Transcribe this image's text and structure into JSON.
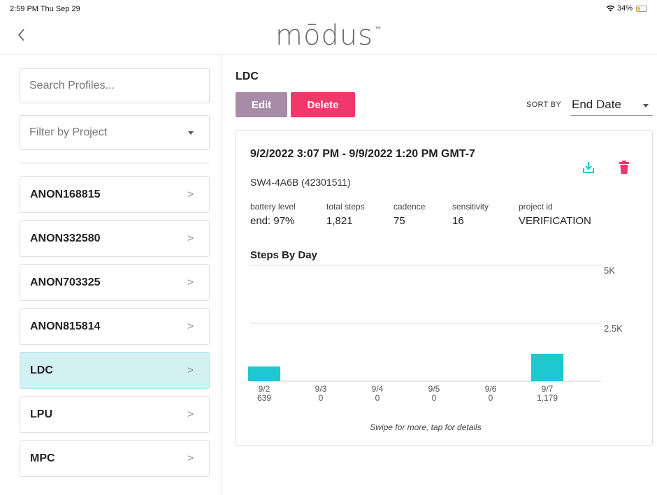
{
  "status_bar": {
    "time": "2:59 PM  Thu Sep 29",
    "battery": "34%",
    "battery_level": 0.34
  },
  "nav": {
    "logo": "mōdus",
    "logo_tm": "™"
  },
  "sidebar": {
    "search_placeholder": "Search Profiles...",
    "filter_label": "Filter by Project",
    "profiles": [
      {
        "name": "ANON168815"
      },
      {
        "name": "ANON332580"
      },
      {
        "name": "ANON703325"
      },
      {
        "name": "ANON815814"
      },
      {
        "name": "LDC"
      },
      {
        "name": "LPU"
      },
      {
        "name": "MPC"
      }
    ],
    "selected": "LDC"
  },
  "main": {
    "title": "LDC",
    "edit_label": "Edit",
    "delete_label": "Delete",
    "sort_label": "SORT BY",
    "sort_value": "End Date"
  },
  "card": {
    "date_range": "9/2/2022 3:07 PM - 9/9/2022 1:20 PM GMT-7",
    "device": "SW4-4A6B (42301511)",
    "stats": [
      {
        "label": "battery level",
        "value": "end: 97%"
      },
      {
        "label": "total steps",
        "value": "1,821"
      },
      {
        "label": "cadence",
        "value": "75"
      },
      {
        "label": "sensitivity",
        "value": "16"
      },
      {
        "label": "project id",
        "value": "VERIFICATION"
      }
    ],
    "chart_hint": "Swipe for more, tap for details"
  },
  "colors": {
    "accent": "#1fc8d0",
    "edit": "#a88ba6",
    "delete": "#f0386b",
    "selected_bg": "#d3f1f3"
  },
  "chart_data": {
    "type": "bar",
    "title": "Steps By Day",
    "categories": [
      "9/2",
      "9/3",
      "9/4",
      "9/5",
      "9/6",
      "9/7"
    ],
    "value_labels": [
      "639",
      "0",
      "0",
      "0",
      "0",
      "1,179"
    ],
    "values": [
      639,
      0,
      0,
      0,
      0,
      1179
    ],
    "y_ticks": [
      "5K",
      "2.5K"
    ],
    "y_tick_values": [
      5000,
      2500
    ],
    "ylim": [
      0,
      5000
    ],
    "grid": true,
    "bar_color": "#1fc8d0"
  }
}
